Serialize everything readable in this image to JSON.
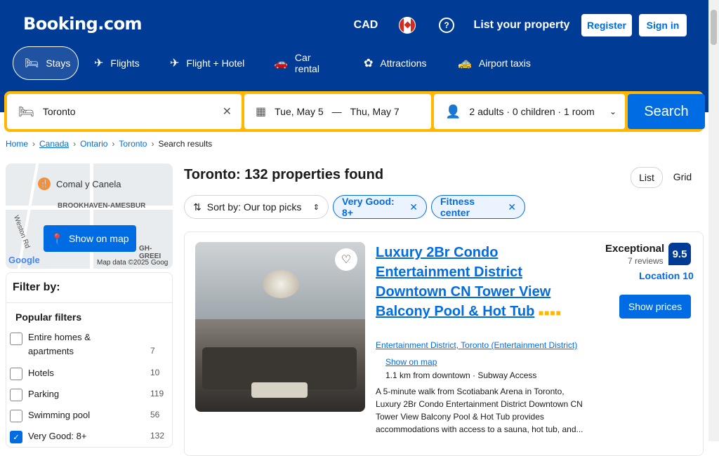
{
  "header": {
    "logo": "Booking.com",
    "currency": "CAD",
    "help_glyph": "?",
    "list_property": "List your property",
    "register": "Register",
    "sign_in": "Sign in"
  },
  "tabs": [
    {
      "label": "Stays",
      "icon": "bed-icon",
      "glyph": "🛏"
    },
    {
      "label": "Flights",
      "icon": "plane-icon",
      "glyph": "✈"
    },
    {
      "label": "Flight + Hotel",
      "icon": "flight-hotel-icon",
      "glyph": "✈"
    },
    {
      "label": "Car rental",
      "icon": "car-icon",
      "glyph": "🚗"
    },
    {
      "label": "Attractions",
      "icon": "attractions-icon",
      "glyph": "✿"
    },
    {
      "label": "Airport taxis",
      "icon": "taxi-icon",
      "glyph": "🚕"
    }
  ],
  "search": {
    "destination": "Toronto",
    "check_in": "Tue, May 5",
    "dash": "—",
    "check_out": "Thu, May 7",
    "guests": "2 adults · 0 children · 1 room",
    "submit": "Search"
  },
  "breadcrumb": [
    "Home",
    "Canada",
    "Ontario",
    "Toronto",
    "Search results"
  ],
  "map": {
    "label1": "Comal y Canela",
    "label2": "BROOKHAVEN-AMESBUR",
    "label3": "Weston Rd",
    "label4": "GH-GREEI",
    "credit": "Map data ©2025 Goog",
    "google": "Google",
    "button": "Show on map"
  },
  "filters": {
    "title": "Filter by:",
    "section": "Popular filters",
    "items": [
      {
        "label": "Entire homes & apartments",
        "count": "7",
        "checked": false
      },
      {
        "label": "Hotels",
        "count": "10",
        "checked": false
      },
      {
        "label": "Parking",
        "count": "119",
        "checked": false
      },
      {
        "label": "Swimming pool",
        "count": "56",
        "checked": false
      },
      {
        "label": "Very Good: 8+",
        "count": "132",
        "checked": true
      }
    ]
  },
  "results": {
    "title": "Toronto: 132 properties found",
    "view_list": "List",
    "view_grid": "Grid",
    "sort": "Sort by: Our top picks",
    "chips": [
      "Very Good: 8+",
      "Fitness center"
    ]
  },
  "property": {
    "name": "Luxury 2Br Condo Entertainment District Downtown CN Tower View Balcony Pool & Hot Tub",
    "stars": "■■■■",
    "location": "Entertainment District, Toronto (Entertainment District)",
    "show_on_map": "Show on map",
    "distance": "1.1 km from downtown · Subway Access",
    "description": "A 5-minute walk from Scotiabank Arena in Toronto, Luxury 2Br Condo Entertainment District Downtown CN Tower View Balcony Pool & Hot Tub provides accommodations with access to a sauna, hot tub, and...",
    "score_word": "Exceptional",
    "reviews": "7 reviews",
    "score": "9.5",
    "location_score": "Location 10",
    "button": "Show prices"
  }
}
